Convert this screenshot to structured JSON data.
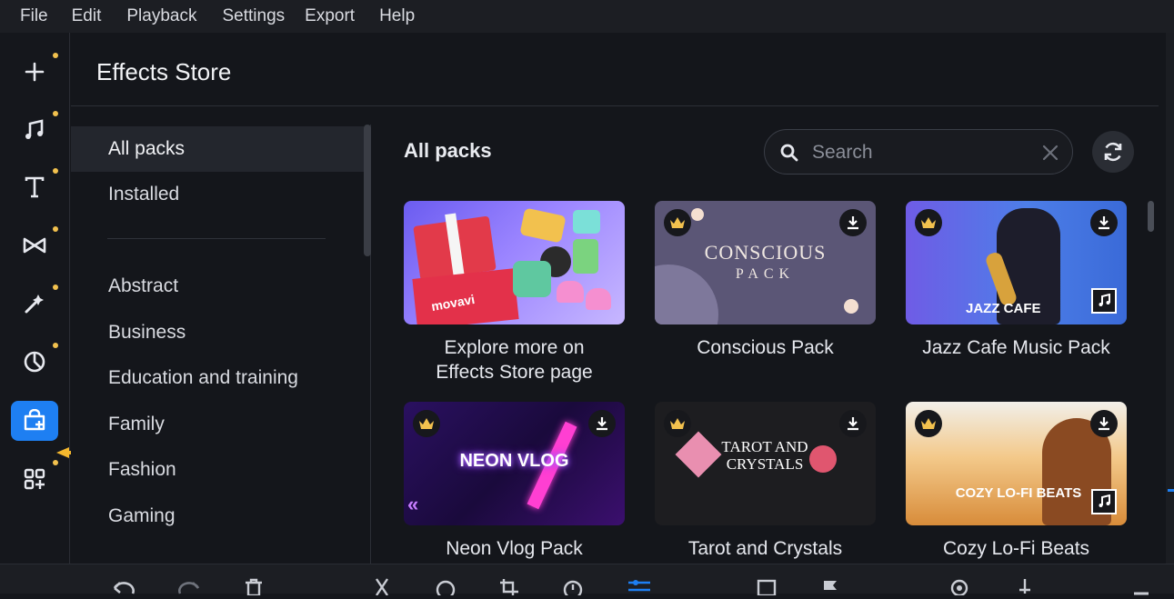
{
  "menu": [
    "File",
    "Edit",
    "Playback",
    "Settings",
    "Export",
    "Help"
  ],
  "rail": [
    {
      "name": "add-media-icon"
    },
    {
      "name": "music-icon"
    },
    {
      "name": "titles-icon"
    },
    {
      "name": "transitions-icon"
    },
    {
      "name": "filters-icon"
    },
    {
      "name": "stickers-icon"
    },
    {
      "name": "effects-store-icon",
      "active": true
    },
    {
      "name": "more-tools-icon"
    }
  ],
  "panel": {
    "title": "Effects Store"
  },
  "categories": {
    "top": [
      "All packs",
      "Installed"
    ],
    "list": [
      "Abstract",
      "Business",
      "Education and training",
      "Family",
      "Fashion",
      "Gaming"
    ],
    "selected": "All packs"
  },
  "content": {
    "title": "All packs",
    "search_placeholder": "Search"
  },
  "cards": [
    {
      "label": "Explore more on Effects Store page",
      "thumb_text": "movavi",
      "premium": false
    },
    {
      "label": "Conscious Pack",
      "thumb_text": "CONSCIOUS",
      "thumb_sub": "PACK",
      "premium": true
    },
    {
      "label": "Jazz Cafe Music Pack",
      "thumb_text": "JAZZ CAFE",
      "premium": true
    },
    {
      "label": "Neon Vlog Pack",
      "thumb_text": "NEON VLOG",
      "premium": true
    },
    {
      "label": "Tarot and Crystals",
      "thumb_text": "TAROT AND CRYSTALS",
      "premium": true
    },
    {
      "label": "Cozy Lo-Fi Beats",
      "thumb_text": "COZY LO-FI BEATS",
      "premium": true
    }
  ],
  "colors": {
    "accent": "#1e7ff2",
    "dot": "#f2c14e",
    "crown": "#f2c14e"
  }
}
